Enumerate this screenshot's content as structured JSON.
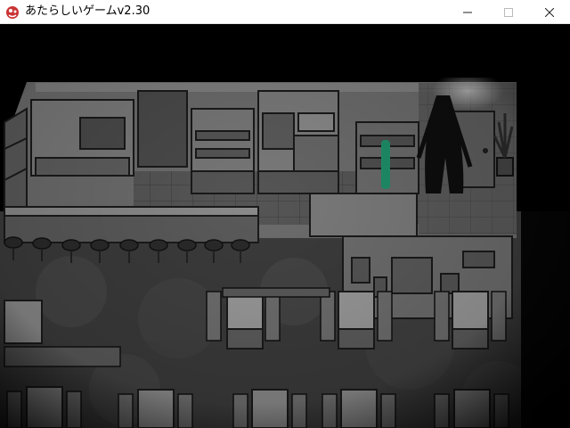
{
  "window": {
    "title": "あたらしいゲームv2.30",
    "app_icon": "game-app-icon",
    "controls": {
      "minimize": "minimize-icon",
      "maximize": "maximize-icon",
      "close": "close-icon"
    }
  },
  "scene": {
    "description_icons": [
      "kitchen-shelf-icon",
      "counter-icon",
      "bar-stool-icon",
      "dining-table-icon",
      "chair-icon",
      "shadow-figure-icon",
      "door-icon",
      "plant-icon"
    ],
    "accent_color": "#1f8f6a",
    "floor_color": "#3a3a3a",
    "wall_color": "#6a6a6a"
  }
}
